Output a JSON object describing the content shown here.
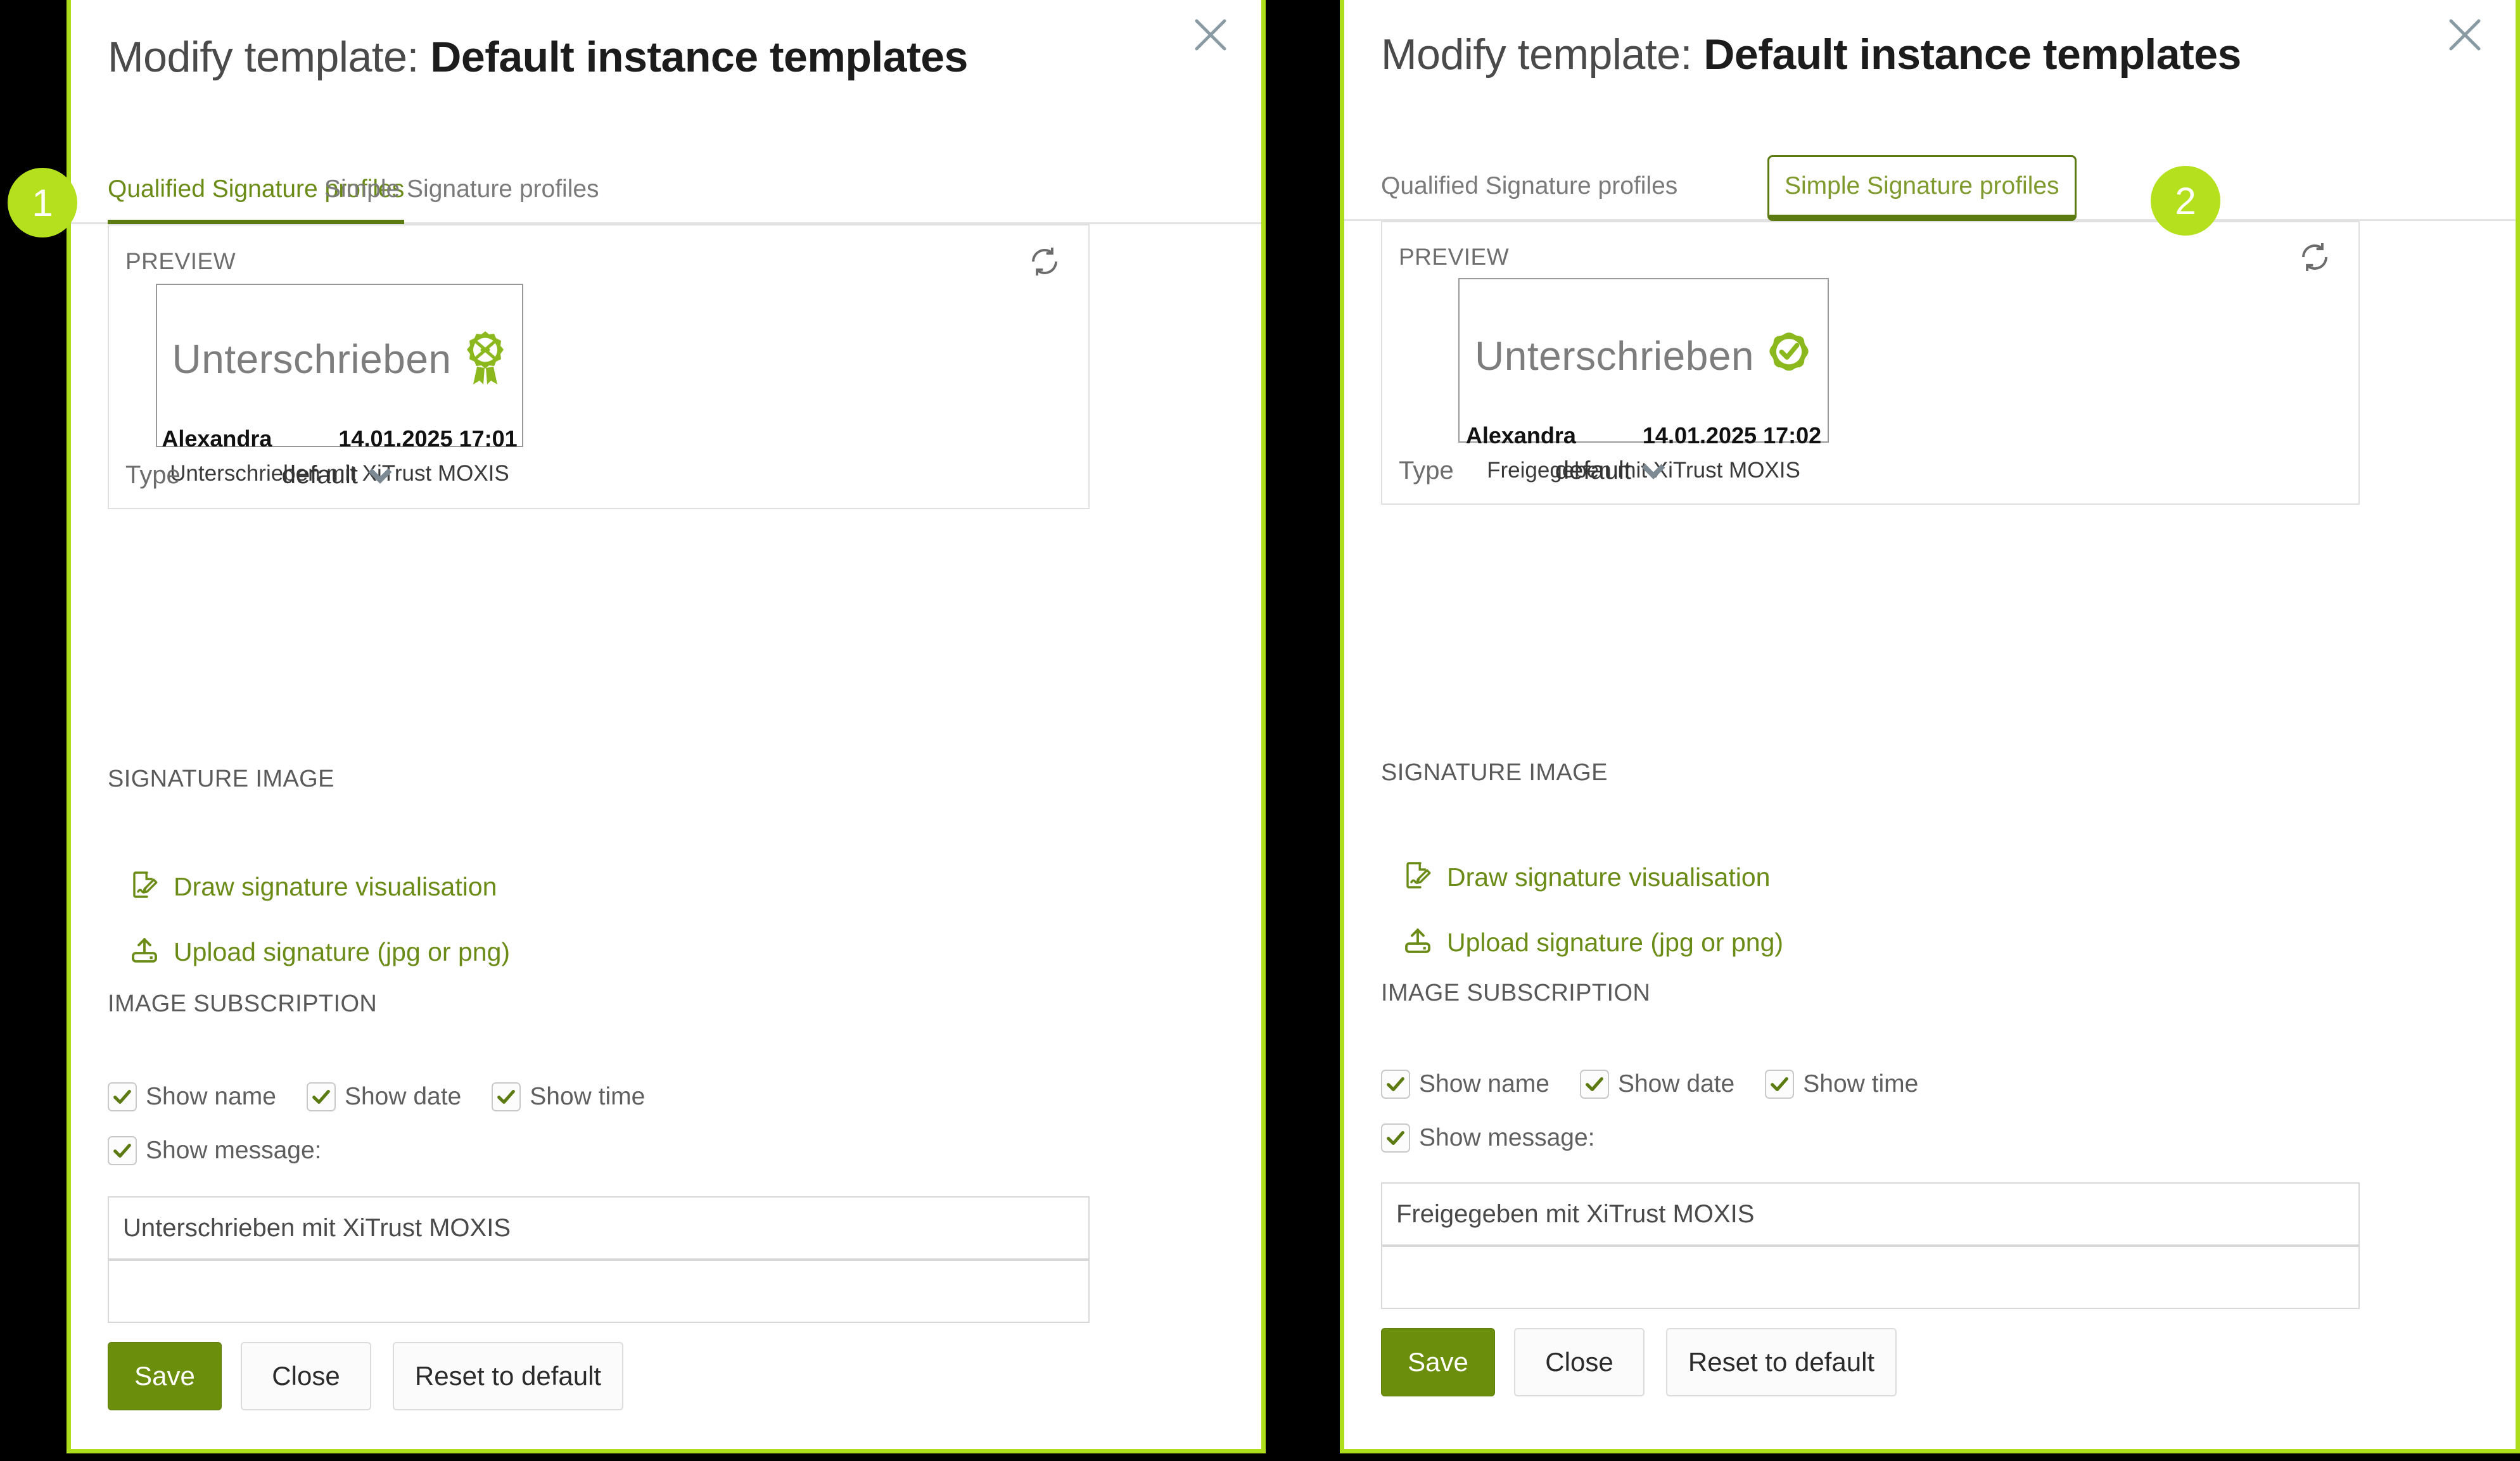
{
  "panels": [
    {
      "id": "qualified",
      "close_icon": "close-icon",
      "title_prefix": "Modify template: ",
      "title_strong": "Default instance templates",
      "badge": "1",
      "tabs": [
        {
          "label": "Qualified Signature profiles",
          "state": "active"
        },
        {
          "label": "Simple Signature profiles",
          "state": "inactive"
        }
      ],
      "preview": {
        "label": "PREVIEW",
        "refresh_icon": "refresh-icon",
        "seal_icon": "xitrust-rosette-seal-icon",
        "signature_word": "Unterschrieben",
        "signer_name": "Alexandra",
        "signed_at": "14.01.2025 17:01",
        "signature_message": "Unterschrieben mit XiTrust MOXIS",
        "type_label": "Type",
        "type_value": "default"
      },
      "signature_image": {
        "heading": "SIGNATURE IMAGE",
        "draw_label": "Draw signature visualisation",
        "draw_icon": "document-pencil-icon",
        "upload_label": "Upload signature (jpg or png)",
        "upload_icon": "upload-icon"
      },
      "image_subscription": {
        "heading": "IMAGE SUBSCRIPTION",
        "checkboxes": [
          {
            "label": "Show name",
            "checked": true
          },
          {
            "label": "Show date",
            "checked": true
          },
          {
            "label": "Show time",
            "checked": true
          }
        ],
        "show_message": {
          "label": "Show message:",
          "checked": true
        },
        "message_value": "Unterschrieben mit XiTrust MOXIS",
        "message_line2": ""
      },
      "buttons": {
        "save": "Save",
        "close": "Close",
        "reset": "Reset to default"
      }
    },
    {
      "id": "simple",
      "close_icon": "close-icon",
      "title_prefix": "Modify template: ",
      "title_strong": "Default instance templates",
      "badge": "2",
      "tabs": [
        {
          "label": "Qualified Signature profiles",
          "state": "inactive"
        },
        {
          "label": "Simple Signature profiles",
          "state": "active-boxed"
        }
      ],
      "preview": {
        "label": "PREVIEW",
        "refresh_icon": "refresh-icon",
        "seal_icon": "check-rosette-seal-icon",
        "signature_word": "Unterschrieben",
        "signer_name": "Alexandra",
        "signed_at": "14.01.2025 17:02",
        "signature_message": "Freigegeben mit XiTrust MOXIS",
        "type_label": "Type",
        "type_value": "default"
      },
      "signature_image": {
        "heading": "SIGNATURE IMAGE",
        "draw_label": "Draw signature visualisation",
        "draw_icon": "document-pencil-icon",
        "upload_label": "Upload signature (jpg or png)",
        "upload_icon": "upload-icon"
      },
      "image_subscription": {
        "heading": "IMAGE SUBSCRIPTION",
        "checkboxes": [
          {
            "label": "Show name",
            "checked": true
          },
          {
            "label": "Show date",
            "checked": true
          },
          {
            "label": "Show time",
            "checked": true
          }
        ],
        "show_message": {
          "label": "Show message:",
          "checked": true
        },
        "message_value": "Freigegeben mit XiTrust MOXIS",
        "message_line2": ""
      },
      "buttons": {
        "save": "Save",
        "close": "Close",
        "reset": "Reset to default"
      }
    }
  ],
  "colors": {
    "panel_border": "#AEDD1E",
    "badge": "#B4E01E",
    "accent_green": "#6b8b17",
    "save_green": "#6B8E0C",
    "tab_active_underline": "#5c7a12",
    "seal_green": "#8BB81C",
    "background": "#000000"
  }
}
